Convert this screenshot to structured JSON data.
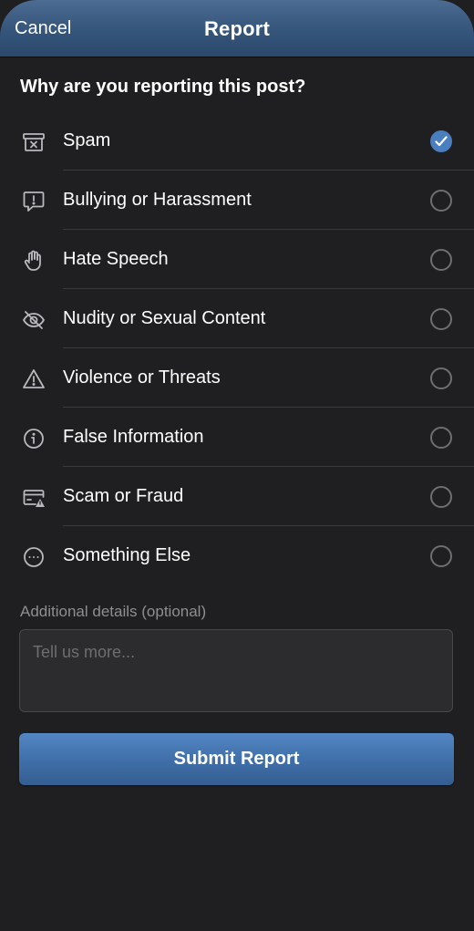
{
  "header": {
    "cancel_label": "Cancel",
    "title": "Report"
  },
  "question": "Why are you reporting this post?",
  "options": [
    {
      "label": "Spam",
      "icon": "spam-box-icon",
      "selected": true
    },
    {
      "label": "Bullying or Harassment",
      "icon": "speech-bubble-alert-icon",
      "selected": false
    },
    {
      "label": "Hate Speech",
      "icon": "hand-icon",
      "selected": false
    },
    {
      "label": "Nudity or Sexual Content",
      "icon": "eye-slash-icon",
      "selected": false
    },
    {
      "label": "Violence or Threats",
      "icon": "warning-triangle-icon",
      "selected": false
    },
    {
      "label": "False Information",
      "icon": "info-circle-icon",
      "selected": false
    },
    {
      "label": "Scam or Fraud",
      "icon": "card-warning-icon",
      "selected": false
    },
    {
      "label": "Something Else",
      "icon": "ellipsis-circle-icon",
      "selected": false
    }
  ],
  "details": {
    "label": "Additional details (optional)",
    "placeholder": "Tell us more...",
    "value": ""
  },
  "submit_label": "Submit Report",
  "colors": {
    "accent": "#4a7fbf",
    "header": "#38587e",
    "background": "#1f1f21"
  }
}
